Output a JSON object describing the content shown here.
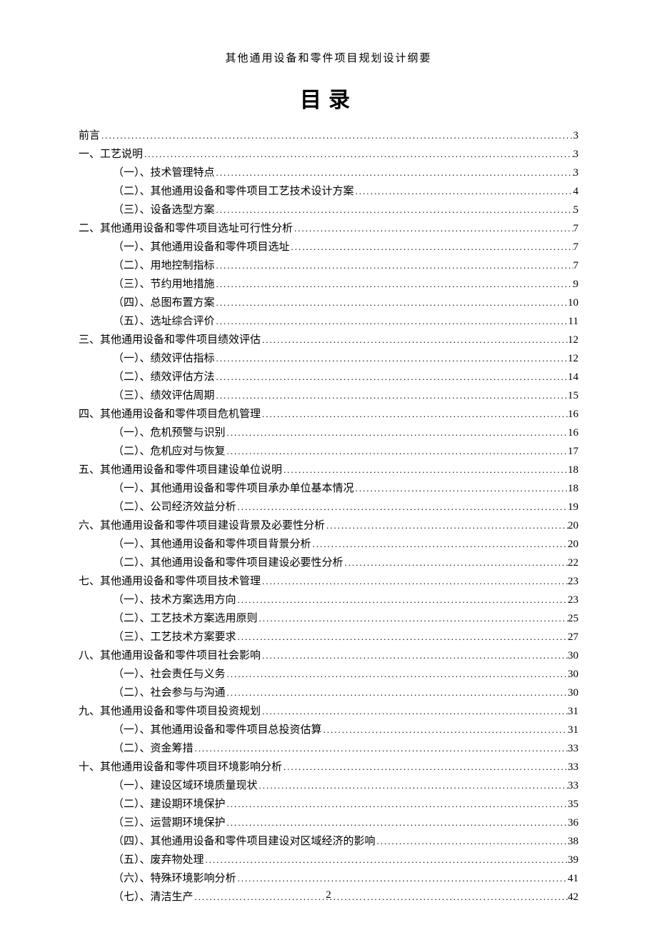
{
  "running_head": "其他通用设备和零件项目规划设计纲要",
  "toc_title": "目录",
  "page_number": "2",
  "entries": [
    {
      "level": 1,
      "label": "前言",
      "page": "3"
    },
    {
      "level": 1,
      "label": "一、工艺说明",
      "page": "3"
    },
    {
      "level": 2,
      "label": "（一）、技术管理特点",
      "page": "3"
    },
    {
      "level": 2,
      "label": "（二）、其他通用设备和零件项目工艺技术设计方案",
      "page": "4"
    },
    {
      "level": 2,
      "label": "（三）、设备选型方案",
      "page": "5"
    },
    {
      "level": 1,
      "label": "二、其他通用设备和零件项目选址可行性分析",
      "page": "7"
    },
    {
      "level": 2,
      "label": "（一）、其他通用设备和零件项目选址",
      "page": "7"
    },
    {
      "level": 2,
      "label": "（二）、用地控制指标",
      "page": "7"
    },
    {
      "level": 2,
      "label": "（三）、节约用地措施",
      "page": "9"
    },
    {
      "level": 2,
      "label": "（四）、总图布置方案",
      "page": "10"
    },
    {
      "level": 2,
      "label": "（五）、选址综合评价",
      "page": "11"
    },
    {
      "level": 1,
      "label": "三、其他通用设备和零件项目绩效评估",
      "page": "12"
    },
    {
      "level": 2,
      "label": "（一）、绩效评估指标",
      "page": "12"
    },
    {
      "level": 2,
      "label": "（二）、绩效评估方法",
      "page": "14"
    },
    {
      "level": 2,
      "label": "（三）、绩效评估周期",
      "page": "15"
    },
    {
      "level": 1,
      "label": "四、其他通用设备和零件项目危机管理",
      "page": "16"
    },
    {
      "level": 2,
      "label": "（一）、危机预警与识别",
      "page": "16"
    },
    {
      "level": 2,
      "label": "（二）、危机应对与恢复",
      "page": "17"
    },
    {
      "level": 1,
      "label": "五、其他通用设备和零件项目建设单位说明",
      "page": "18"
    },
    {
      "level": 2,
      "label": "（一）、其他通用设备和零件项目承办单位基本情况",
      "page": "18"
    },
    {
      "level": 2,
      "label": "（二）、公司经济效益分析",
      "page": "19"
    },
    {
      "level": 1,
      "label": "六、其他通用设备和零件项目建设背景及必要性分析",
      "page": "20"
    },
    {
      "level": 2,
      "label": "（一）、其他通用设备和零件项目背景分析",
      "page": "20"
    },
    {
      "level": 2,
      "label": "（二）、其他通用设备和零件项目建设必要性分析",
      "page": "22"
    },
    {
      "level": 1,
      "label": "七、其他通用设备和零件项目技术管理",
      "page": "23"
    },
    {
      "level": 2,
      "label": "（一）、技术方案选用方向",
      "page": "23"
    },
    {
      "level": 2,
      "label": "（二）、工艺技术方案选用原则",
      "page": "25"
    },
    {
      "level": 2,
      "label": "（三）、工艺技术方案要求",
      "page": "27"
    },
    {
      "level": 1,
      "label": "八、其他通用设备和零件项目社会影响",
      "page": "30"
    },
    {
      "level": 2,
      "label": "（一）、社会责任与义务",
      "page": "30"
    },
    {
      "level": 2,
      "label": "（二）、社会参与与沟通",
      "page": "30"
    },
    {
      "level": 1,
      "label": "九、其他通用设备和零件项目投资规划",
      "page": "31"
    },
    {
      "level": 2,
      "label": "（一）、其他通用设备和零件项目总投资估算",
      "page": "31"
    },
    {
      "level": 2,
      "label": "（二）、资金筹措",
      "page": "33"
    },
    {
      "level": 1,
      "label": "十、其他通用设备和零件项目环境影响分析",
      "page": "33"
    },
    {
      "level": 2,
      "label": "（一）、建设区域环境质量现状",
      "page": "33"
    },
    {
      "level": 2,
      "label": "（二）、建设期环境保护",
      "page": "35"
    },
    {
      "level": 2,
      "label": "（三）、运营期环境保护",
      "page": "36"
    },
    {
      "level": 2,
      "label": "（四）、其他通用设备和零件项目建设对区域经济的影响",
      "page": "38"
    },
    {
      "level": 2,
      "label": "（五）、废弃物处理",
      "page": "39"
    },
    {
      "level": 2,
      "label": "（六）、特殊环境影响分析",
      "page": "41"
    },
    {
      "level": 2,
      "label": "（七）、清洁生产",
      "page": "42"
    }
  ]
}
